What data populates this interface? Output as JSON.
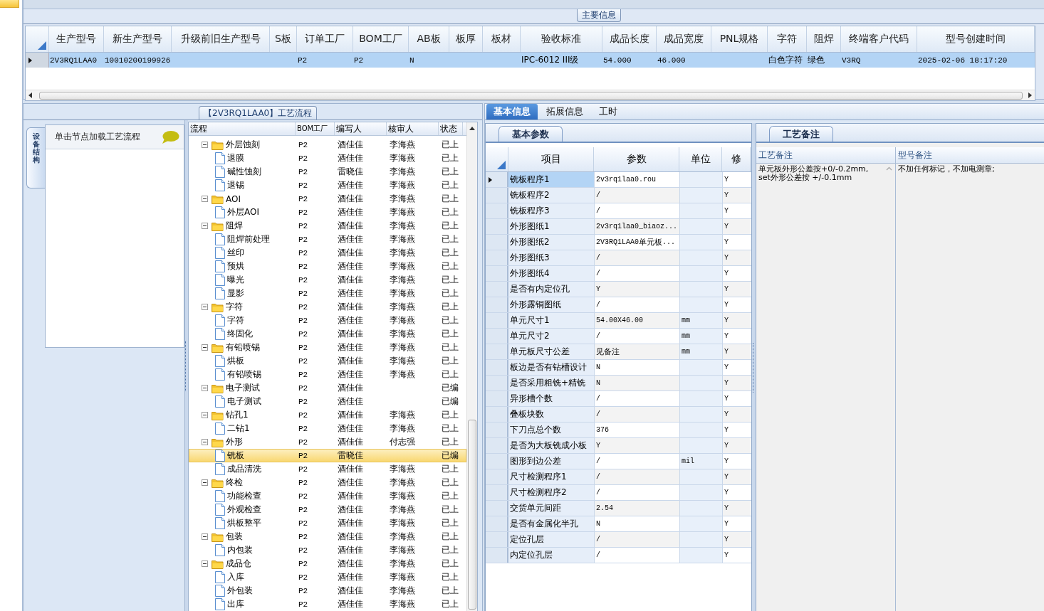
{
  "main_info": {
    "title": "主要信息",
    "columns": [
      "生产型号",
      "新生产型号",
      "升级前旧生产型号",
      "S板",
      "订单工厂",
      "BOM工厂",
      "AB板",
      "板厚",
      "板材",
      "验收标准",
      "成品长度",
      "成品宽度",
      "PNL规格",
      "字符",
      "阻焊",
      "终端客户代码",
      "型号创建时间"
    ],
    "rows": [
      {
        "selected": true,
        "cells": [
          "2V3RQ1LAA0",
          "10010200199926",
          null,
          null,
          "P2",
          "P2",
          "N",
          null,
          null,
          "IPC-6012 III级",
          "54.000",
          "46.000",
          null,
          "白色字符",
          "绿色",
          "V3RQ",
          "2025-02-06 18:17:20"
        ]
      }
    ]
  },
  "process": {
    "title": "【2V3RQ1LAA0】工艺流程",
    "side_tab": "设备结构",
    "hint": "单击节点加载工艺流程",
    "columns": [
      "流程",
      "BOM工厂",
      "编写人",
      "核审人",
      "状态"
    ],
    "tree": [
      {
        "name": "外层蚀刻",
        "bom": "P2",
        "author": "酒佳佳",
        "reviewer": "李海燕",
        "status": "已上",
        "expanded": true,
        "selected": false,
        "children": [
          {
            "name": "退膜",
            "bom": "P2",
            "author": "酒佳佳",
            "reviewer": "李海燕",
            "status": "已上",
            "selected": false
          },
          {
            "name": "碱性蚀刻",
            "bom": "P2",
            "author": "雷晓佳",
            "reviewer": "李海燕",
            "status": "已上",
            "selected": false
          },
          {
            "name": "退锡",
            "bom": "P2",
            "author": "酒佳佳",
            "reviewer": "李海燕",
            "status": "已上",
            "selected": false
          }
        ]
      },
      {
        "name": "AOI",
        "bom": "P2",
        "author": "酒佳佳",
        "reviewer": "李海燕",
        "status": "已上",
        "expanded": true,
        "selected": false,
        "children": [
          {
            "name": "外层AOI",
            "bom": "P2",
            "author": "酒佳佳",
            "reviewer": "李海燕",
            "status": "已上",
            "selected": false
          }
        ]
      },
      {
        "name": "阻焊",
        "bom": "P2",
        "author": "酒佳佳",
        "reviewer": "李海燕",
        "status": "已上",
        "expanded": true,
        "selected": false,
        "children": [
          {
            "name": "阻焊前处理",
            "bom": "P2",
            "author": "酒佳佳",
            "reviewer": "李海燕",
            "status": "已上",
            "selected": false
          },
          {
            "name": "丝印",
            "bom": "P2",
            "author": "酒佳佳",
            "reviewer": "李海燕",
            "status": "已上",
            "selected": false
          },
          {
            "name": "预烘",
            "bom": "P2",
            "author": "酒佳佳",
            "reviewer": "李海燕",
            "status": "已上",
            "selected": false
          },
          {
            "name": "曝光",
            "bom": "P2",
            "author": "酒佳佳",
            "reviewer": "李海燕",
            "status": "已上",
            "selected": false
          },
          {
            "name": "显影",
            "bom": "P2",
            "author": "酒佳佳",
            "reviewer": "李海燕",
            "status": "已上",
            "selected": false
          }
        ]
      },
      {
        "name": "字符",
        "bom": "P2",
        "author": "酒佳佳",
        "reviewer": "李海燕",
        "status": "已上",
        "expanded": true,
        "selected": false,
        "children": [
          {
            "name": "字符",
            "bom": "P2",
            "author": "酒佳佳",
            "reviewer": "李海燕",
            "status": "已上",
            "selected": false
          },
          {
            "name": "终固化",
            "bom": "P2",
            "author": "酒佳佳",
            "reviewer": "李海燕",
            "status": "已上",
            "selected": false
          }
        ]
      },
      {
        "name": "有铅喷锡",
        "bom": "P2",
        "author": "酒佳佳",
        "reviewer": "李海燕",
        "status": "已上",
        "expanded": true,
        "selected": false,
        "children": [
          {
            "name": "烘板",
            "bom": "P2",
            "author": "酒佳佳",
            "reviewer": "李海燕",
            "status": "已上",
            "selected": false
          },
          {
            "name": "有铅喷锡",
            "bom": "P2",
            "author": "酒佳佳",
            "reviewer": "李海燕",
            "status": "已上",
            "selected": false
          }
        ]
      },
      {
        "name": "电子测试",
        "bom": "P2",
        "author": "酒佳佳",
        "status": "已编",
        "expanded": true,
        "selected": false,
        "children": [
          {
            "name": "电子测试",
            "bom": "P2",
            "author": "酒佳佳",
            "status": "已编",
            "selected": false
          }
        ]
      },
      {
        "name": "钻孔1",
        "bom": "P2",
        "author": "酒佳佳",
        "reviewer": "李海燕",
        "status": "已上",
        "expanded": true,
        "selected": false,
        "children": [
          {
            "name": "二钻1",
            "bom": "P2",
            "author": "酒佳佳",
            "reviewer": "李海燕",
            "status": "已上",
            "selected": false
          }
        ]
      },
      {
        "name": "外形",
        "bom": "P2",
        "author": "酒佳佳",
        "reviewer": "付志强",
        "status": "已上",
        "expanded": true,
        "selected": false,
        "children": [
          {
            "name": "铣板",
            "bom": "P2",
            "author": "雷晓佳",
            "status": "已编",
            "selected": true
          },
          {
            "name": "成品清洗",
            "bom": "P2",
            "author": "酒佳佳",
            "reviewer": "李海燕",
            "status": "已上",
            "selected": false
          }
        ]
      },
      {
        "name": "终检",
        "bom": "P2",
        "author": "酒佳佳",
        "reviewer": "李海燕",
        "status": "已上",
        "expanded": true,
        "selected": false,
        "children": [
          {
            "name": "功能检查",
            "bom": "P2",
            "author": "酒佳佳",
            "reviewer": "李海燕",
            "status": "已上",
            "selected": false
          },
          {
            "name": "外观检查",
            "bom": "P2",
            "author": "酒佳佳",
            "reviewer": "李海燕",
            "status": "已上",
            "selected": false
          },
          {
            "name": "烘板整平",
            "bom": "P2",
            "author": "酒佳佳",
            "reviewer": "李海燕",
            "status": "已上",
            "selected": false
          }
        ]
      },
      {
        "name": "包装",
        "bom": "P2",
        "author": "酒佳佳",
        "reviewer": "李海燕",
        "status": "已上",
        "expanded": true,
        "selected": false,
        "children": [
          {
            "name": "内包装",
            "bom": "P2",
            "author": "酒佳佳",
            "reviewer": "李海燕",
            "status": "已上",
            "selected": false
          }
        ]
      },
      {
        "name": "成品仓",
        "bom": "P2",
        "author": "酒佳佳",
        "reviewer": "李海燕",
        "status": "已上",
        "expanded": true,
        "selected": false,
        "children": [
          {
            "name": "入库",
            "bom": "P2",
            "author": "酒佳佳",
            "reviewer": "李海燕",
            "status": "已上",
            "selected": false
          },
          {
            "name": "外包装",
            "bom": "P2",
            "author": "酒佳佳",
            "reviewer": "李海燕",
            "status": "已上",
            "selected": false
          },
          {
            "name": "出库",
            "bom": "P2",
            "author": "酒佳佳",
            "reviewer": "李海燕",
            "status": "已上",
            "selected": false
          }
        ]
      }
    ]
  },
  "detail": {
    "tabs": [
      {
        "label": "基本信息",
        "selected": true
      },
      {
        "label": "拓展信息",
        "selected": false
      },
      {
        "label": "工时",
        "selected": false
      }
    ],
    "params": {
      "title": "基本参数",
      "columns": [
        "项目",
        "参数",
        "单位",
        "修"
      ],
      "rows": [
        {
          "item": "铣板程序1",
          "value": "2v3rq1laa0.rou",
          "modified": "Y",
          "selected": true
        },
        {
          "item": "铣板程序2",
          "value": "/",
          "modified": "Y",
          "selected": false
        },
        {
          "item": "铣板程序3",
          "value": "/",
          "modified": "Y",
          "selected": false
        },
        {
          "item": "外形图纸1",
          "value": "2v3rq1laa0_biaoz...",
          "modified": "Y",
          "selected": false
        },
        {
          "item": "外形图纸2",
          "value": "2V3RQ1LAA0单元板...",
          "modified": "Y",
          "selected": false
        },
        {
          "item": "外形图纸3",
          "value": "/",
          "modified": "Y",
          "selected": false
        },
        {
          "item": "外形图纸4",
          "value": "/",
          "modified": "Y",
          "selected": false
        },
        {
          "item": "是否有内定位孔",
          "value": "Y",
          "modified": "Y",
          "selected": false
        },
        {
          "item": "外形露铜图纸",
          "value": "/",
          "modified": "Y",
          "selected": false
        },
        {
          "item": "单元尺寸1",
          "value": "54.00X46.00",
          "unit": "mm",
          "modified": "Y",
          "selected": false
        },
        {
          "item": "单元尺寸2",
          "value": "/",
          "unit": "mm",
          "modified": "Y",
          "selected": false
        },
        {
          "item": "单元板尺寸公差",
          "value": "见备注",
          "unit": "mm",
          "modified": "Y",
          "selected": false
        },
        {
          "item": "板边是否有钻槽设计",
          "value": "N",
          "modified": "Y",
          "selected": false
        },
        {
          "item": "是否采用粗铣+精铣",
          "value": "N",
          "modified": "Y",
          "selected": false
        },
        {
          "item": "异形槽个数",
          "value": "/",
          "modified": "Y",
          "selected": false
        },
        {
          "item": "叠板块数",
          "value": "/",
          "modified": "Y",
          "selected": false
        },
        {
          "item": "下刀点总个数",
          "value": "376",
          "modified": "Y",
          "selected": false
        },
        {
          "item": "是否为大板铣成小板",
          "value": "Y",
          "modified": "Y",
          "selected": false
        },
        {
          "item": "图形到边公差",
          "value": "/",
          "unit": "mil",
          "modified": "Y",
          "selected": false
        },
        {
          "item": "尺寸检测程序1",
          "value": "/",
          "modified": "Y",
          "selected": false
        },
        {
          "item": "尺寸检测程序2",
          "value": "/",
          "modified": "Y",
          "selected": false
        },
        {
          "item": "交货单元间距",
          "value": "2.54",
          "modified": "Y",
          "selected": false
        },
        {
          "item": "是否有金属化半孔",
          "value": "N",
          "modified": "Y",
          "selected": false
        },
        {
          "item": "定位孔层",
          "value": "/",
          "modified": "Y",
          "selected": false
        },
        {
          "item": "内定位孔层",
          "value": "/",
          "modified": "Y",
          "selected": false
        }
      ]
    },
    "notes": {
      "title": "工艺备注",
      "columns": [
        "工艺备注",
        "型号备注"
      ],
      "process_note": "单元板外形公差按+0/-0.2mm,\nset外形公差按 +/-0.1mm",
      "model_note": "不加任何标记，不加电测章;"
    }
  }
}
